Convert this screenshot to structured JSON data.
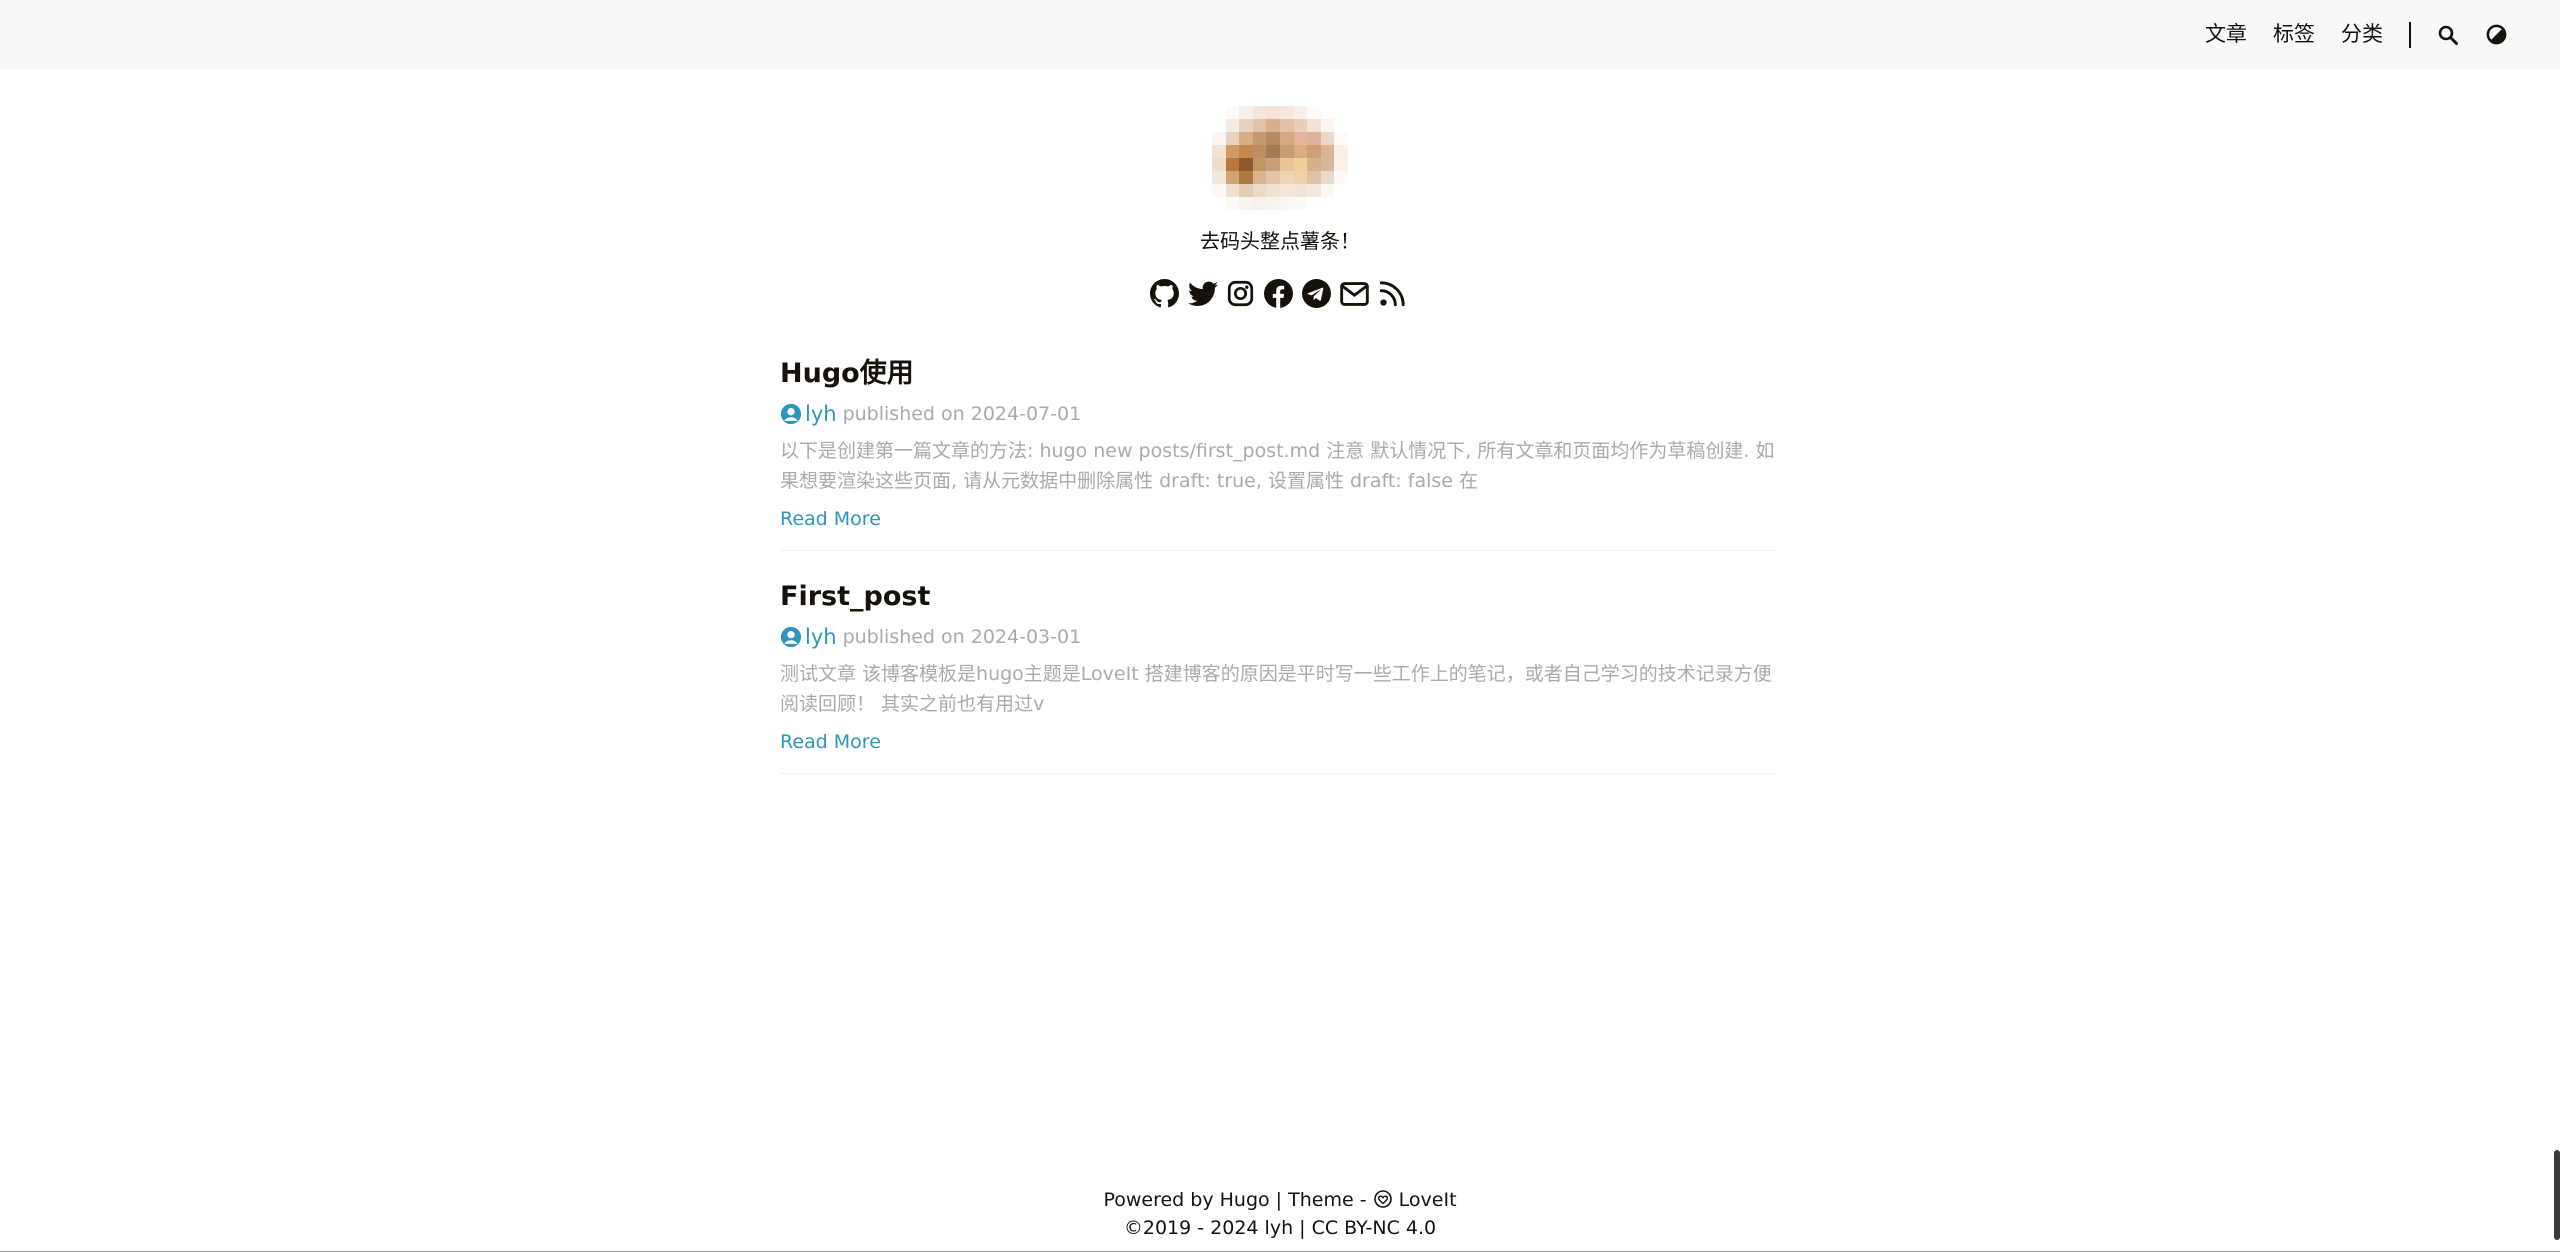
{
  "nav": {
    "posts": "文章",
    "tags": "标签",
    "categories": "分类"
  },
  "profile": {
    "subtitle": "去码头整点薯条！",
    "social_icons": [
      "github-icon",
      "twitter-icon",
      "instagram-icon",
      "facebook-icon",
      "telegram-icon",
      "email-icon",
      "rss-icon"
    ]
  },
  "posts": [
    {
      "title": "Hugo使用",
      "author": "lyh",
      "published": "published on 2024-07-01",
      "summary": "以下是创建第一篇文章的方法: hugo new posts/first_post.md 注意 默认情况下, 所有文章和页面均作为草稿创建. 如果想要渲染这些页面, 请从元数据中删除属性 draft: true, 设置属性 draft: false 在",
      "read_more": "Read More"
    },
    {
      "title": "First_post",
      "author": "lyh",
      "published": "published on 2024-03-01",
      "summary": "测试文章 该博客模板是hugo主题是LoveIt 搭建博客的原因是平时写一些工作上的笔记，或者自己学习的技术记录方便阅读回顾！ 其实之前也有用过v",
      "read_more": "Read More"
    }
  ],
  "footer": {
    "powered_by": "Powered by Hugo | Theme - ",
    "theme_name": "LoveIt",
    "copyright": "2019 - 2024 lyh | CC BY-NC 4.0"
  },
  "colors": {
    "accent": "#2d96bd",
    "muted": "#a9a9b3",
    "header_bg": "#f8f8f8"
  }
}
